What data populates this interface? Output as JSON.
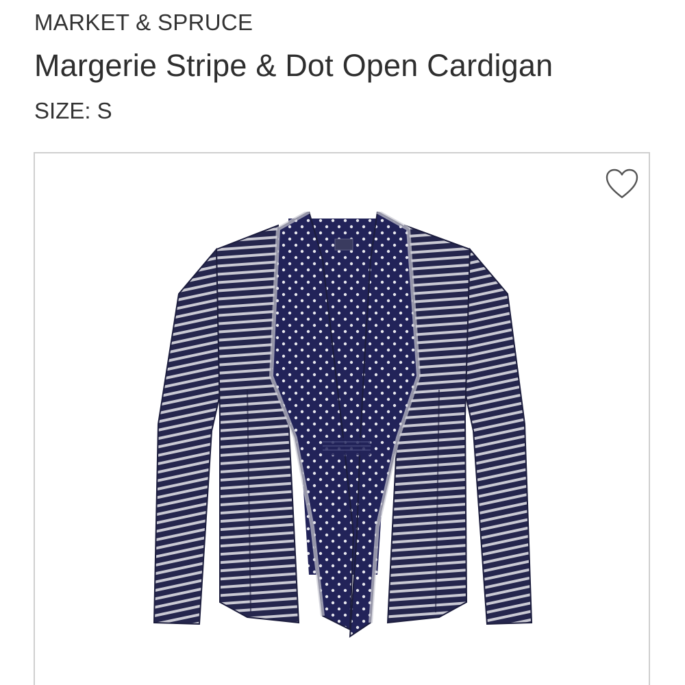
{
  "product": {
    "brand": "MARKET & SPRUCE",
    "name": "Margerie Stripe & Dot Open Cardigan",
    "size_label": "SIZE: S"
  },
  "image": {
    "subject": "cardigan-photo",
    "favorite_icon": "heart-outline-icon"
  },
  "colors": {
    "navy": "#25264d",
    "stripe_light": "#c9c9d3",
    "border": "#cfcfcf",
    "text": "#333333"
  }
}
